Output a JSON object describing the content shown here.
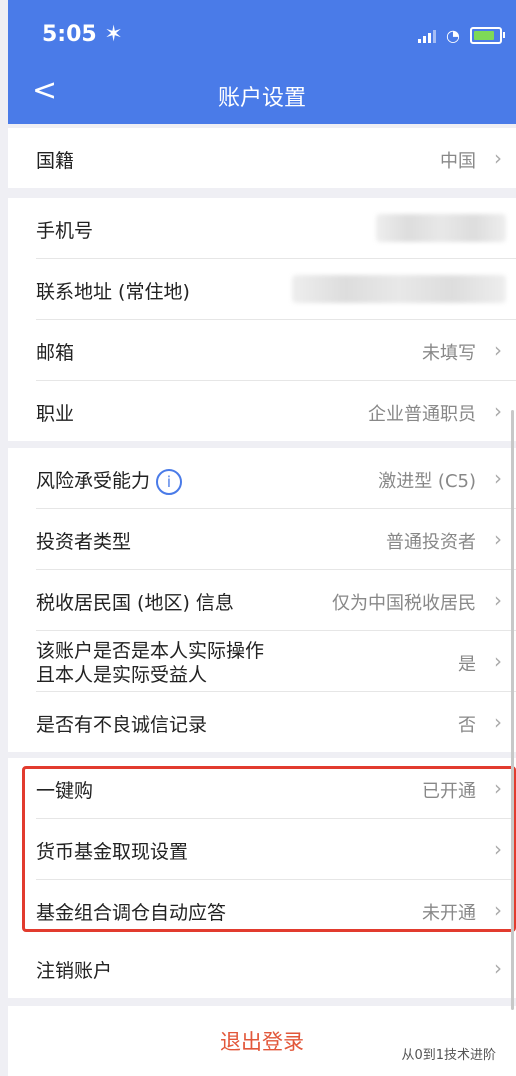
{
  "status": {
    "time": "5:05 ✶"
  },
  "nav": {
    "back": "<",
    "title": "账户设置"
  },
  "group1": {
    "nationality": {
      "label": "国籍",
      "value": "中国"
    }
  },
  "group2": {
    "phone": {
      "label": "手机号"
    },
    "address": {
      "label": "联系地址 (常住地)"
    },
    "email": {
      "label": "邮箱",
      "value": "未填写"
    },
    "job": {
      "label": "职业",
      "value": "企业普通职员"
    }
  },
  "group3": {
    "risk": {
      "label": "风险承受能力",
      "icon": "i",
      "value": "激进型 (C5)"
    },
    "investor": {
      "label": "投资者类型",
      "value": "普通投资者"
    },
    "tax": {
      "label": "税收居民国 (地区) 信息",
      "value": "仅为中国税收居民"
    },
    "owner": {
      "label1": "该账户是否是本人实际操作",
      "label2": "且本人是实际受益人",
      "value": "是"
    },
    "credit": {
      "label": "是否有不良诚信记录",
      "value": "否"
    }
  },
  "group4": {
    "onekey": {
      "label": "一键购",
      "value": "已开通"
    },
    "cash": {
      "label": "货币基金取现设置"
    },
    "auto": {
      "label": "基金组合调仓自动应答",
      "value": "未开通"
    }
  },
  "group5": {
    "cancel": {
      "label": "注销账户"
    }
  },
  "logout": {
    "label": "退出登录"
  },
  "watermark": "从0到1技术进阶",
  "colors": {
    "header": "#4a7be8",
    "highlight": "#e23b2e",
    "logout": "#e2573a"
  }
}
